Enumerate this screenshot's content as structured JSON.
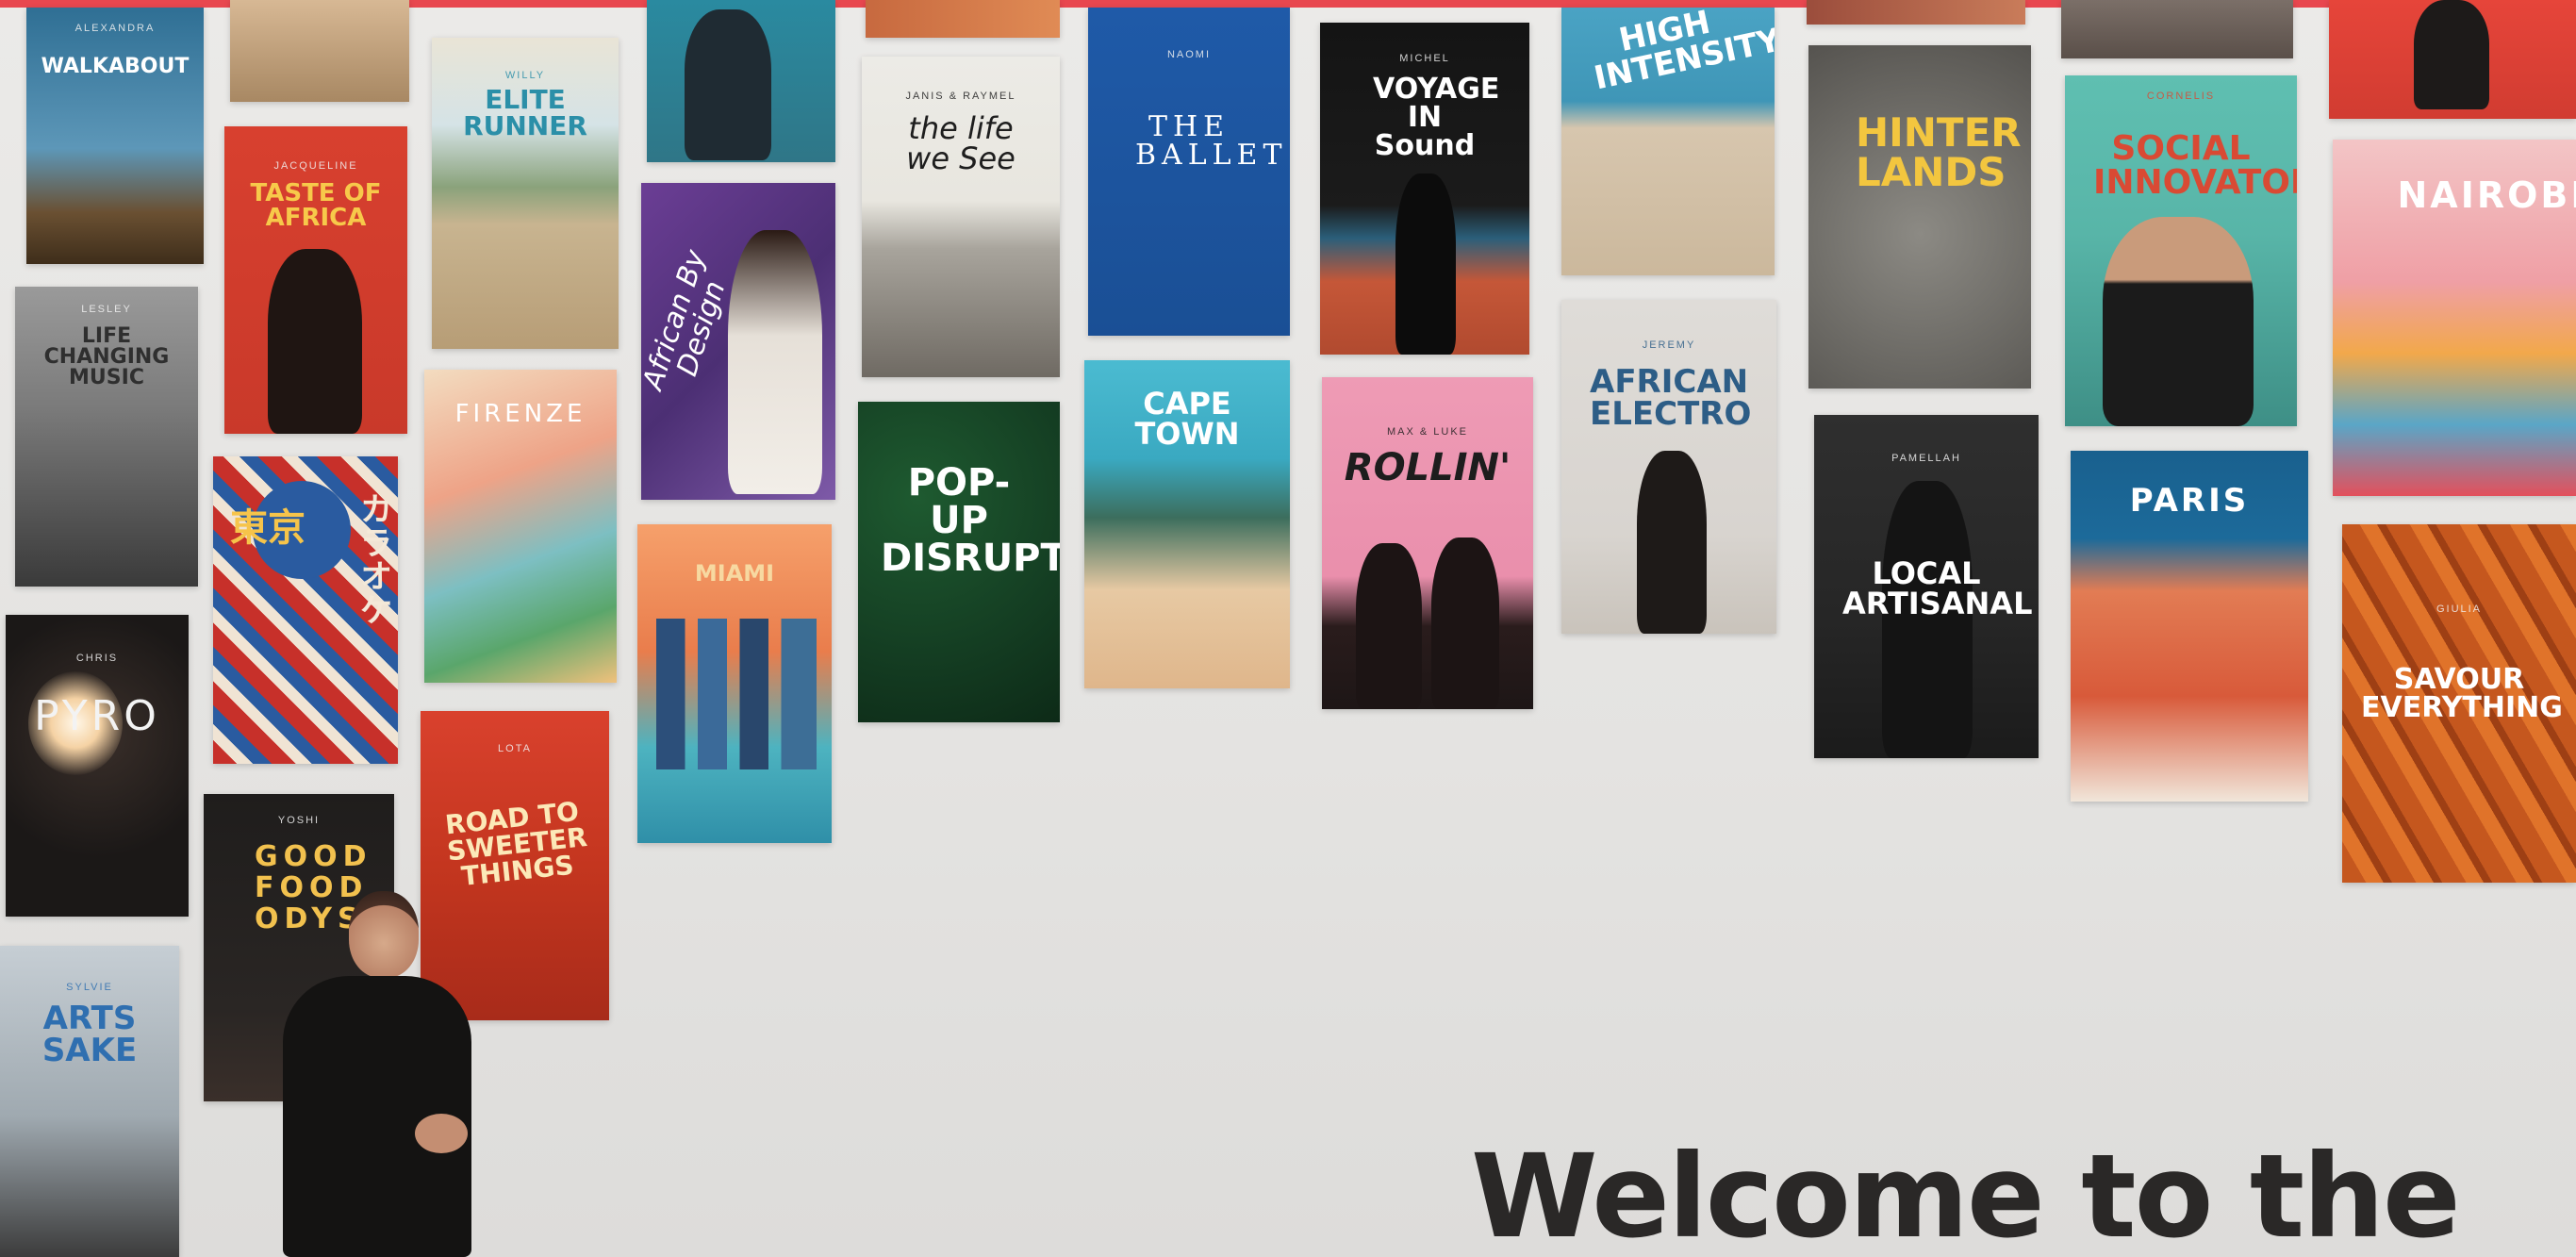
{
  "slide": {
    "headline": "Welcome to the",
    "accent_color": "#e8474f"
  },
  "cards": [
    {
      "id": "walkabout",
      "name": "ALEXANDRA",
      "title": "WALKABOUT",
      "bg": "#2f6f94",
      "fg": "#ffffff"
    },
    {
      "id": "taste-of-africa",
      "name": "JACQUELINE",
      "title": "TASTE OF AFRICA",
      "bg": "#d8402f",
      "fg": "#f7c94a"
    },
    {
      "id": "life-changing-music",
      "name": "LESLEY",
      "title": "LIFE CHANGING MUSIC",
      "bg": "#8b8b8b",
      "fg": "#3a3a3a"
    },
    {
      "id": "tokyo-karaoke",
      "name": "",
      "title": "東京",
      "subtitle": "カラオケ",
      "bg": "#c7302a",
      "fg": "#ffffff"
    },
    {
      "id": "pyro",
      "name": "CHRIS",
      "title": "PYRO",
      "bg": "#1b1817",
      "fg": "#f3f3f3"
    },
    {
      "id": "good-food-odyssey",
      "name": "YOSHI",
      "title": "GOOD FOOD ODYSSEY",
      "bg": "#1f1d1c",
      "fg": "#f2c14e"
    },
    {
      "id": "arts-sake",
      "name": "SYLVIE",
      "title": "ARTS SAKE",
      "bg": "#b9c4cc",
      "fg": "#2f6fb0"
    },
    {
      "id": "elite-runner",
      "name": "WILLY",
      "title": "ELITE RUNNER",
      "bg": "#cfc6ad",
      "fg": "#2b8fa8"
    },
    {
      "id": "firenze",
      "name": "",
      "title": "FIRENZE",
      "bg": "#f1d3b4",
      "fg": "#ffffff"
    },
    {
      "id": "road-to-sweeter-things",
      "name": "LOTA",
      "title": "ROAD TO SWEETER THINGS",
      "bg": "#d9412d",
      "fg": "#fce9b8"
    },
    {
      "id": "african-by-design",
      "name": "",
      "title": "African By Design",
      "bg": "#5c3a86",
      "fg": "#ffffff"
    },
    {
      "id": "miami",
      "name": "",
      "title": "MIAMI",
      "bg": "#f08a57",
      "fg": "#f7d9a1"
    },
    {
      "id": "the-life-we-see",
      "name": "JANIS & RAYMEL",
      "title": "the life we See",
      "bg": "#ecebe6",
      "fg": "#1e1e1e"
    },
    {
      "id": "pop-up-disrupt",
      "name": "",
      "title": "POP-UP DISRUPT",
      "bg": "#143d22",
      "fg": "#ffffff"
    },
    {
      "id": "the-ballet",
      "name": "NAOMI",
      "title": "THE BALLET",
      "bg": "#1f5aa8",
      "fg": "#ffffff"
    },
    {
      "id": "cape-town",
      "name": "",
      "title": "CAPE TOWN",
      "bg": "#4bbbd1",
      "fg": "#ffffff"
    },
    {
      "id": "voyage-in-sound",
      "name": "MICHEL",
      "title": "VOYAGE IN Sound",
      "bg": "#141414",
      "fg": "#ffffff"
    },
    {
      "id": "rollin",
      "name": "MAX & LUKE",
      "title": "ROLLIN'",
      "bg": "#ee9bb5",
      "fg": "#1d1d1d"
    },
    {
      "id": "high-intensity",
      "name": "",
      "title": "HIGH INTENSITY",
      "bg": "#4aa3c4",
      "fg": "#ffffff"
    },
    {
      "id": "african-electro",
      "name": "JEREMY",
      "title": "AFRICAN ELECTRO",
      "bg": "#dfdcd8",
      "fg": "#2d5d86"
    },
    {
      "id": "hinter-lands",
      "name": "",
      "title": "HINTER LANDS",
      "bg": "#6e6c67",
      "fg": "#f3c63f"
    },
    {
      "id": "local-artisanal",
      "name": "PAMELLAH",
      "title": "LOCAL ARTISANAL",
      "bg": "#262626",
      "fg": "#ffffff"
    },
    {
      "id": "social-innovator",
      "name": "CORNELIS",
      "title": "SOCIAL INNOVATOR",
      "bg": "#5fbfb1",
      "fg": "#d94a34"
    },
    {
      "id": "paris",
      "name": "",
      "title": "PARIS",
      "bg": "#19608e",
      "fg": "#ffffff"
    },
    {
      "id": "nairobi",
      "name": "",
      "title": "NAIROBI",
      "bg": "#f3c5c6",
      "fg": "#ffffff"
    },
    {
      "id": "savour-everything",
      "name": "GIULIA",
      "title": "SAVOUR EVERYTHING",
      "bg": "#c5571e",
      "fg": "#ffffff"
    },
    {
      "id": "top-stub-1",
      "name": "",
      "title": "",
      "bg": "#c5a27b",
      "fg": "#ffffff"
    },
    {
      "id": "top-stub-2",
      "name": "",
      "title": "",
      "bg": "#2a8aa0",
      "fg": "#ffffff"
    },
    {
      "id": "top-stub-3",
      "name": "",
      "title": "",
      "bg": "#c7693f",
      "fg": "#ffffff"
    },
    {
      "id": "top-stub-4",
      "name": "",
      "title": "",
      "bg": "#9b4d3c",
      "fg": "#ffffff"
    },
    {
      "id": "top-stub-5",
      "name": "",
      "title": "",
      "bg": "#7b6f68",
      "fg": "#ffffff"
    },
    {
      "id": "top-stub-6",
      "name": "",
      "title": "",
      "bg": "#e6453a",
      "fg": "#ffffff"
    }
  ]
}
